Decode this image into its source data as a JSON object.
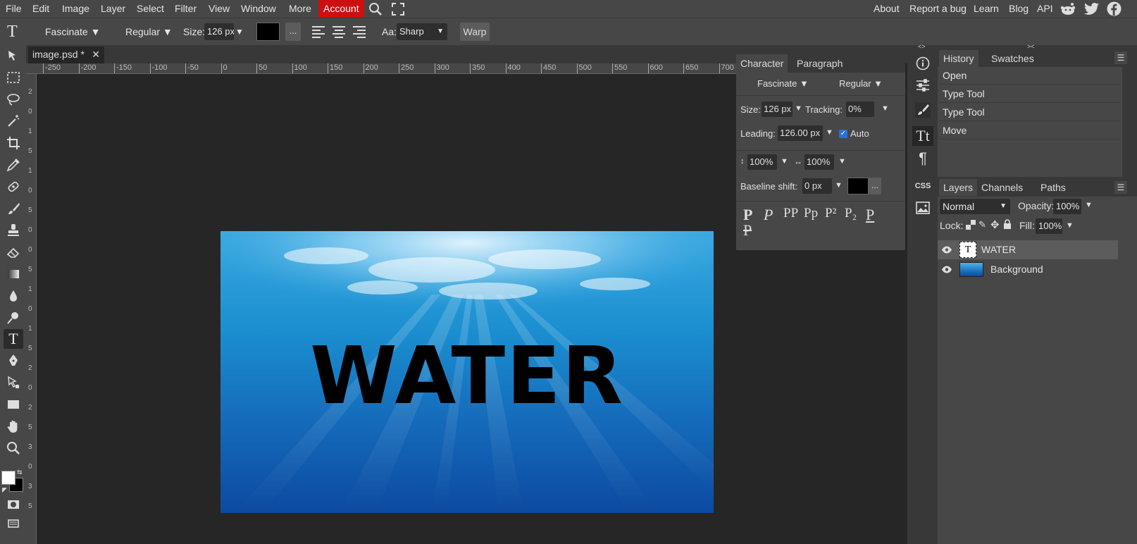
{
  "menubar": {
    "items": [
      "File",
      "Edit",
      "Image",
      "Layer",
      "Select",
      "Filter",
      "View",
      "Window",
      "More"
    ],
    "account": "Account",
    "right_links": [
      "About",
      "Report a bug",
      "Learn",
      "Blog",
      "API"
    ],
    "social_icons": [
      "reddit-icon",
      "twitter-icon",
      "facebook-icon"
    ]
  },
  "options": {
    "tool_glyph": "T",
    "font": "Fascinate ▼",
    "style": "Regular ▼",
    "size_label": "Size:",
    "size_value": "126 px",
    "size_arrow": "▼",
    "color": "#000000",
    "more": "...",
    "aa_label": "Aa:",
    "aa_value": "Sharp",
    "warp": "Warp"
  },
  "document": {
    "tab_title": "image.psd *",
    "close": "✕",
    "canvas_text": "WATER",
    "ruler_h": [
      "-250",
      "-200",
      "-150",
      "-100",
      "-50",
      "0",
      "50",
      "100",
      "150",
      "200",
      "250",
      "300",
      "350",
      "400",
      "450",
      "500",
      "550",
      "600",
      "650",
      "700"
    ],
    "ruler_v": [
      "2",
      "0",
      "1",
      "5",
      "1",
      "0",
      "5",
      "0",
      "0",
      "5",
      "1",
      "0",
      "1",
      "5",
      "2",
      "0",
      "2",
      "5",
      "3",
      "0",
      "3",
      "5"
    ]
  },
  "character_panel": {
    "tab_character": "Character",
    "tab_paragraph": "Paragraph",
    "font": "Fascinate ▼",
    "style": "Regular ▼",
    "size_label": "Size:",
    "size_value": "126 px",
    "tracking_label": "Tracking:",
    "tracking_value": "0%",
    "leading_label": "Leading:",
    "leading_value": "126.00 px",
    "auto_label": "Auto",
    "vscale_value": "100%",
    "hscale_value": "100%",
    "baseline_label": "Baseline shift:",
    "baseline_value": "0 px",
    "more": "...",
    "arrow": "▼",
    "type_styles": [
      "P",
      "P",
      "PP",
      "Pp",
      "P²",
      "P₂",
      "P",
      "P"
    ]
  },
  "icon_column": [
    "info-icon",
    "adjustments-icon",
    "brush-settings-icon",
    "character-icon",
    "paragraph-icon",
    "css-icon",
    "image-icon"
  ],
  "history_panel": {
    "tab_history": "History",
    "tab_swatches": "Swatches",
    "items": [
      "Open",
      "Type Tool",
      "Type Tool",
      "Move"
    ]
  },
  "layers_panel": {
    "tab_layers": "Layers",
    "tab_channels": "Channels",
    "tab_paths": "Paths",
    "blend_mode": "Normal",
    "opacity_label": "Opacity:",
    "opacity_value": "100%",
    "lock_label": "Lock:",
    "fill_label": "Fill:",
    "fill_value": "100%",
    "layers": [
      {
        "name": "WATER",
        "type": "text"
      },
      {
        "name": "Background",
        "type": "image"
      }
    ]
  },
  "colors": {
    "accent_account": "#cc1010",
    "foreground": "#ffffff",
    "background": "#000000"
  }
}
